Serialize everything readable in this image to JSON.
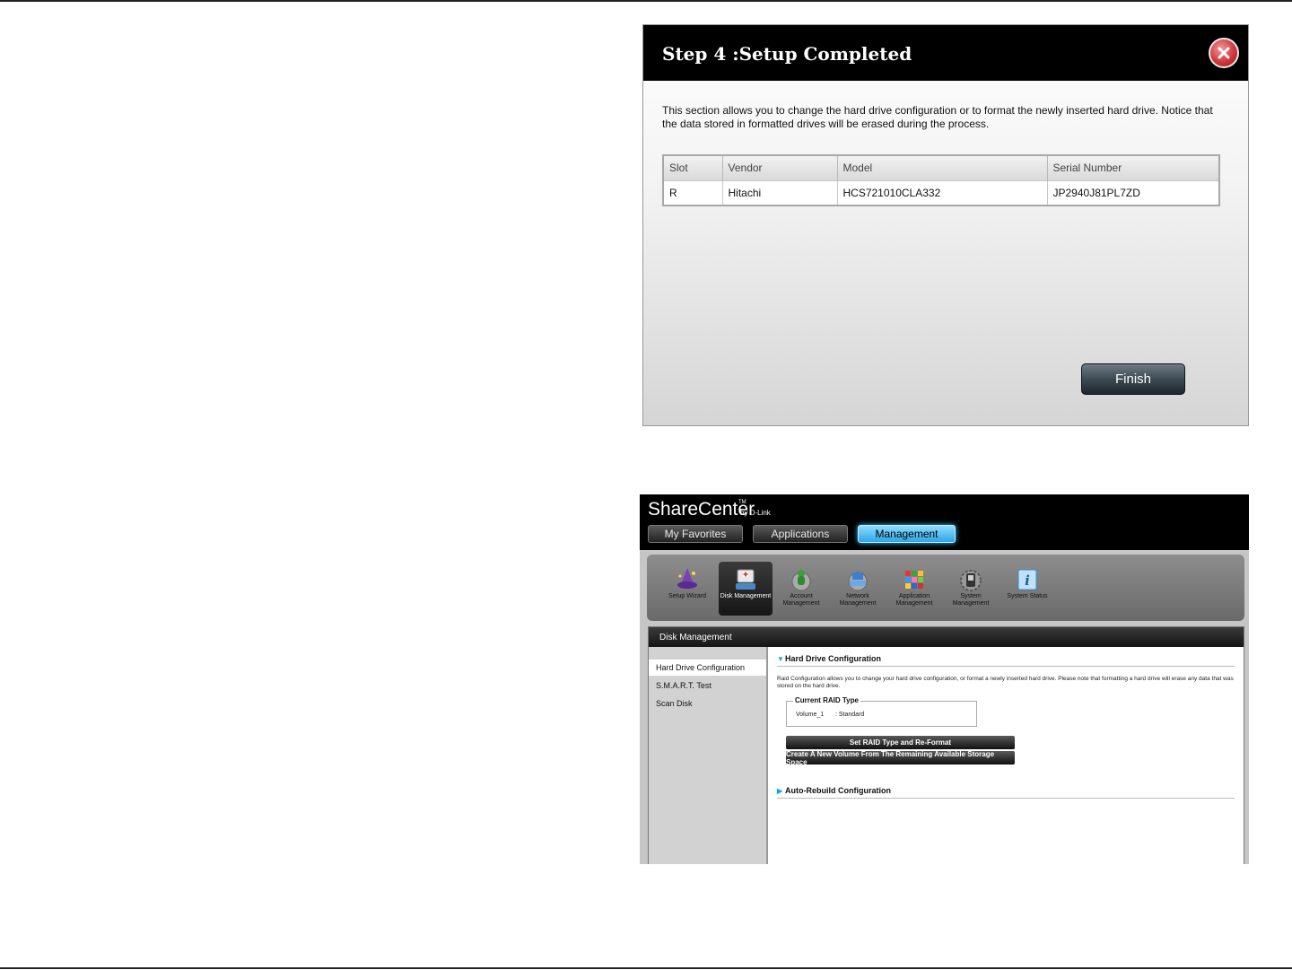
{
  "dialog": {
    "title": "Step 4 :Setup Completed",
    "description": "This section allows you to change the hard drive configuration or to format the newly inserted hard drive. Notice that the data stored in formatted drives will be erased during the process.",
    "table": {
      "columns": [
        "Slot",
        "Vendor",
        "Model",
        "Serial Number"
      ],
      "rows": [
        [
          "R",
          "Hitachi",
          "HCS721010CLA332",
          "JP2940J81PL7ZD"
        ]
      ]
    },
    "finish_label": "Finish",
    "close_icon": "close-icon"
  },
  "app": {
    "brand": "ShareCenter",
    "brand_tm": "TM",
    "brand_sub": "by D-Link",
    "tabs": [
      "My Favorites",
      "Applications",
      "Management"
    ],
    "active_tab": "Management",
    "accent_color": "#3ec3ff",
    "tools": [
      {
        "label": "Setup Wizard",
        "icon": "wizard-icon"
      },
      {
        "label": "Disk Management",
        "icon": "disk-icon"
      },
      {
        "label": "Account Management",
        "icon": "account-icon"
      },
      {
        "label": "Network Management",
        "icon": "network-icon"
      },
      {
        "label": "Application Management",
        "icon": "application-icon"
      },
      {
        "label": "System Management",
        "icon": "system-icon"
      },
      {
        "label": "System Status",
        "icon": "info-icon"
      }
    ],
    "content_title": "Disk Management",
    "sidebar": [
      "Hard Drive Configuration",
      "S.M.A.R.T. Test",
      "Scan Disk"
    ],
    "active_sidebar": "Hard Drive Configuration",
    "section1": {
      "title": "Hard Drive Configuration",
      "description": "Raid Configuration allows you to change your hard drive configuration, or format a newly inserted hard drive. Please note that formatting a hard drive will erase any data that was stored on the hard drive.",
      "raid_legend": "Current RAID Type",
      "raid_volume": "Volume_1",
      "raid_value": ": Standard",
      "button1": "Set RAID Type and Re-Format",
      "button2": "Create A New Volume From The Remaining Available Storage Space"
    },
    "section2": {
      "title": "Auto-Rebuild Configuration"
    }
  }
}
